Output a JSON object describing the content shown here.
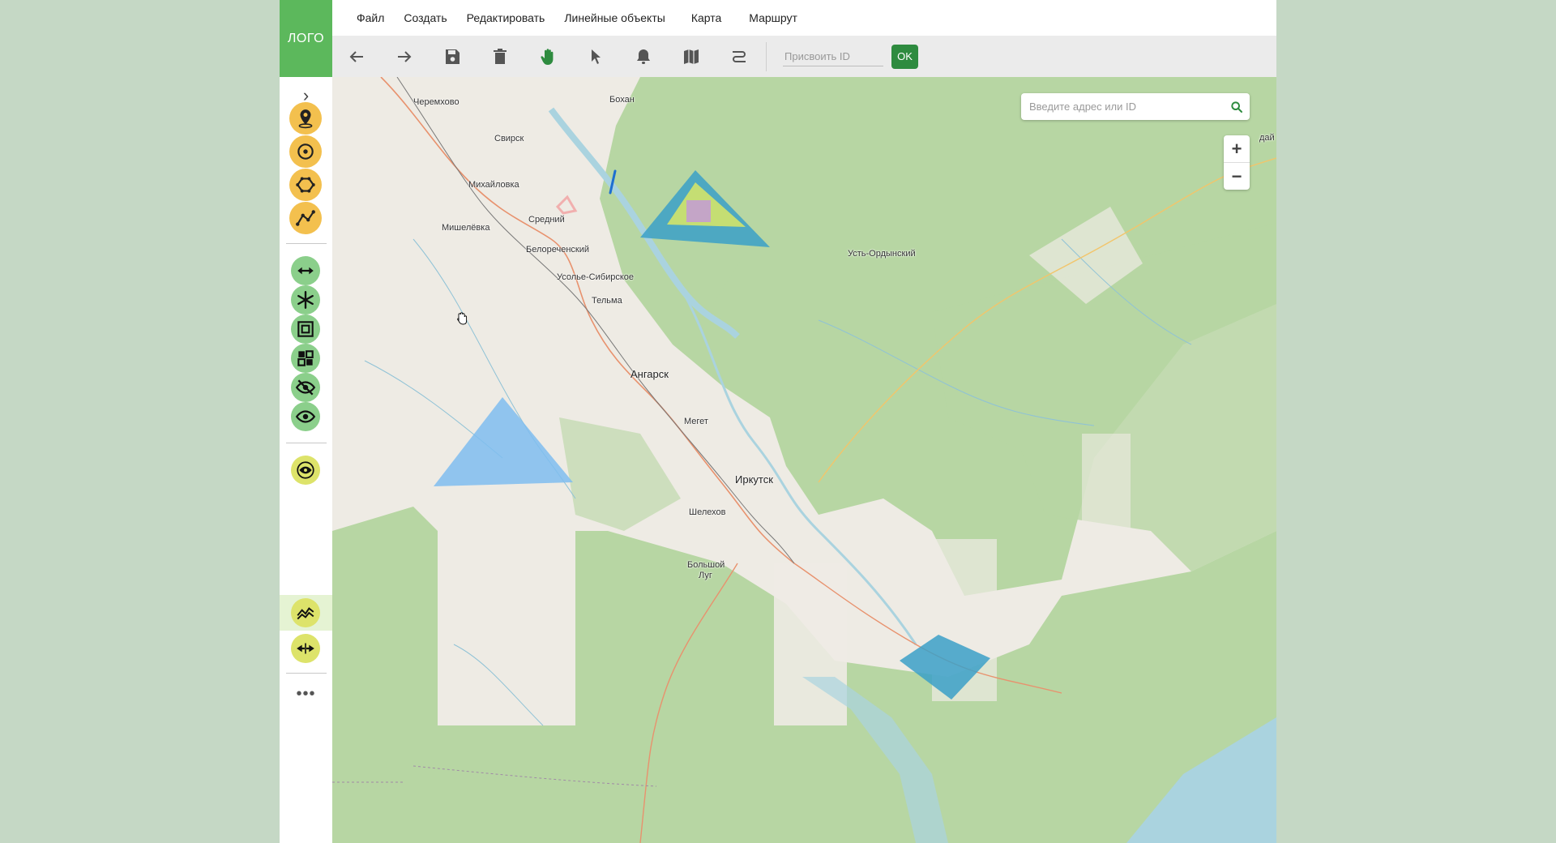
{
  "app": {
    "logo": "ЛОГО"
  },
  "menu": [
    "Файл",
    "Создать",
    "Редактировать",
    "Линейные объекты",
    "Карта",
    "Маршрут"
  ],
  "toolbar": {
    "id_placeholder": "Присвоить ID",
    "ok_label": "OK",
    "buttons": [
      "back-arrow-icon",
      "forward-arrow-icon",
      "save-icon",
      "trash-icon",
      "hand-icon",
      "pointer-icon",
      "bell-icon",
      "map-icon",
      "route-icon"
    ],
    "active_button": "hand-icon",
    "accent_color": "#2e8b3f"
  },
  "sidebar": {
    "group1": [
      "map-pin-icon",
      "circle-target-icon",
      "polygon-icon",
      "polyline-icon"
    ],
    "group2": [
      "horizontal-arrows-icon",
      "snowflake-icon",
      "frame-icon",
      "grid-icon",
      "eye-off-icon",
      "eye-icon"
    ],
    "group3": [
      "eye-ring-icon",
      "chart-lines-icon",
      "merge-arrows-icon"
    ],
    "active_item": "chart-lines-icon",
    "more_label": "•••"
  },
  "map": {
    "search_placeholder": "Введите адрес или ID",
    "zoom_in": "+",
    "zoom_out": "−",
    "cities": [
      {
        "name": "Черемхово",
        "big": false
      },
      {
        "name": "Бохан",
        "big": false
      },
      {
        "name": "Свирск",
        "big": false
      },
      {
        "name": "Михайловка",
        "big": false
      },
      {
        "name": "Средний",
        "big": false
      },
      {
        "name": "Мишелёвка",
        "big": false
      },
      {
        "name": "Белореченский",
        "big": false
      },
      {
        "name": "Усолье-Сибирское",
        "big": false
      },
      {
        "name": "Тельма",
        "big": false
      },
      {
        "name": "Усть-Ордынский",
        "big": false
      },
      {
        "name": "Ангарск",
        "big": true
      },
      {
        "name": "Мегет",
        "big": false
      },
      {
        "name": "Иркутск",
        "big": true
      },
      {
        "name": "Шелехов",
        "big": false
      },
      {
        "name": "Большой",
        "big": false
      },
      {
        "name": "Луг",
        "big": false
      },
      {
        "name": "дай",
        "big": false
      }
    ],
    "colors": {
      "forest": "#b7d6a3",
      "land": "#eeebe4",
      "water": "#aad3df",
      "shape_blue": "#7fbdf0",
      "shape_teal": "#3ba0c8"
    }
  }
}
